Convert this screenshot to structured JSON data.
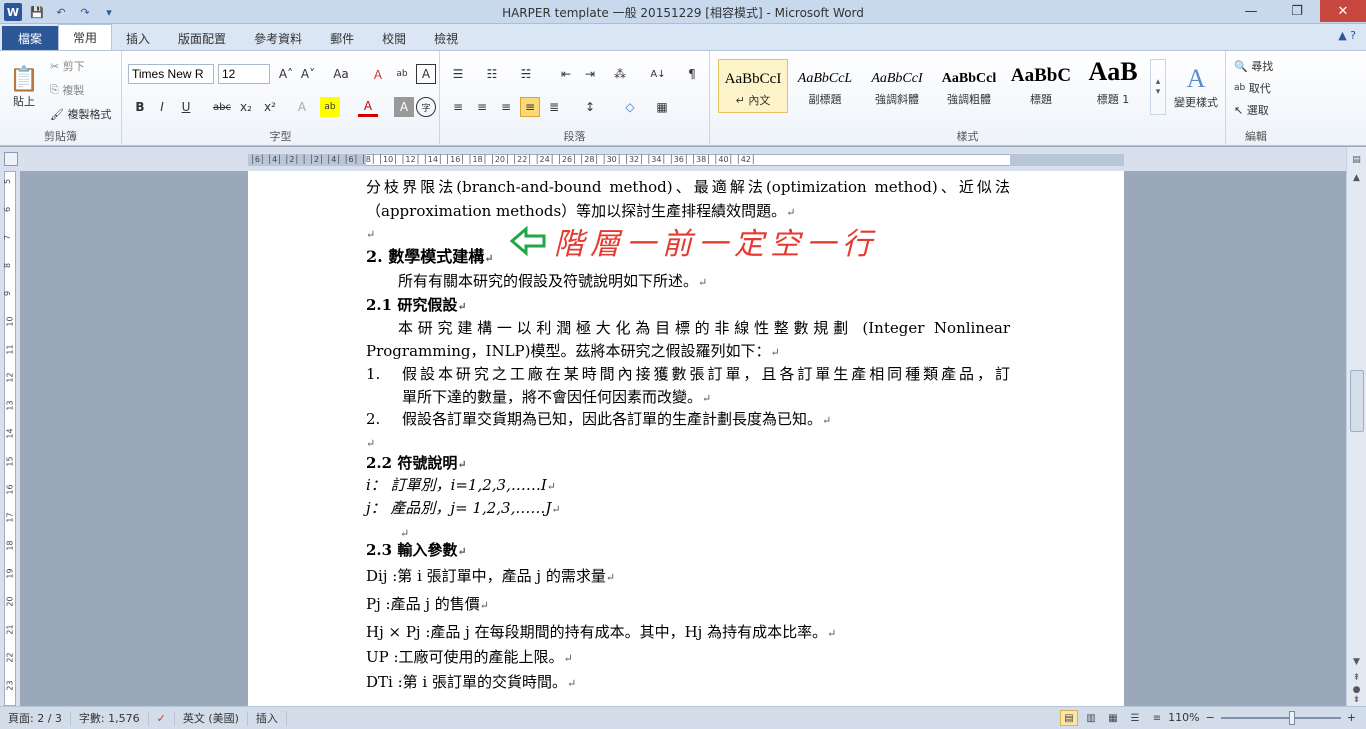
{
  "window": {
    "title": "HARPER template 一般 20151229 [相容模式] - Microsoft Word",
    "qat": {
      "word": "W",
      "save": "💾",
      "undo": "↶",
      "redo": "↷",
      "more": "▾"
    },
    "min": "—",
    "restore": "❐",
    "close": "✕"
  },
  "tabs": [
    {
      "label": "檔案"
    },
    {
      "label": "常用"
    },
    {
      "label": "插入"
    },
    {
      "label": "版面配置"
    },
    {
      "label": "參考資料"
    },
    {
      "label": "郵件"
    },
    {
      "label": "校閱"
    },
    {
      "label": "檢視"
    }
  ],
  "help": "▲ ?",
  "ribbon": {
    "clipboard": {
      "label": "剪貼簿",
      "paste": "貼上",
      "cut": "剪下",
      "copy": "複製",
      "format_painter": "複製格式"
    },
    "font": {
      "label": "字型",
      "name": "Times New R",
      "size": "12",
      "grow": "A˄",
      "shrink": "A˅",
      "case": "Aa",
      "clear": "Ａ",
      "phonetic": "ab",
      "char_border": "A",
      "bold": "B",
      "italic": "I",
      "underline": "U",
      "strike": "abc",
      "sub": "x₂",
      "sup": "x²",
      "effects": "A",
      "highlight": "ab",
      "color": "A",
      "shade": "A",
      "enclose": "字"
    },
    "paragraph": {
      "label": "段落",
      "bullets": "☰",
      "numbering": "☷",
      "multilevel": "☵",
      "decrease": "⇤",
      "increase": "⇥",
      "sort": "A↓",
      "marks": "¶",
      "cjk": "⁂",
      "left": "≡",
      "center": "≡",
      "right": "≡",
      "justify": "≡",
      "distributed": "≣",
      "spacing": "↕",
      "shading": "◇",
      "borders": "▦"
    },
    "styles": {
      "label": "樣式",
      "items": [
        {
          "sample": "AaBbCcI",
          "name": "↵ 內文"
        },
        {
          "sample": "AaBbCcL",
          "name": "副標題"
        },
        {
          "sample": "AaBbCcI",
          "name": "強調斜體"
        },
        {
          "sample": "AaBbCcl",
          "name": "強調粗體"
        },
        {
          "sample": "AaBbC",
          "name": "標題"
        },
        {
          "sample": "AaB",
          "name": "標題 1"
        }
      ],
      "change": "變更樣式"
    },
    "editing": {
      "label": "編輯",
      "find": "尋找",
      "replace": "取代",
      "select": "選取"
    }
  },
  "ruler": {
    "numbers": "│6│  │4│  │2│  │  │2│  │4│  │6│  │8│  │10│ │12│ │14│ │16│ │18│ │20│ │22│ │24│ │26│ │28│ │30│ │32│ │34│ │36│ │38│ │40│ │42│"
  },
  "vruler": [
    "5",
    "6",
    "7",
    "8",
    "9",
    "10",
    "11",
    "12",
    "13",
    "14",
    "15",
    "16",
    "17",
    "18",
    "19",
    "20",
    "21",
    "22",
    "23"
  ],
  "doc": {
    "p1a": "分枝界限法(branch-and-bound method)、最適解法(optimization method)、近似法",
    "p1b": "（approximation methods）等加以探討生產排程績效問題。",
    "mark": "↵",
    "h2": "2.  數學模式建構",
    "annot_red": "階層一前一定空一行",
    "p2": "所有有關本研究的假設及符號說明如下所述。",
    "h21": "2.1  研究假設",
    "p3a": "本研究建構一以利潤極大化為目標的非線性整數規劃 (Integer Nonlinear",
    "p3b": "Programming，INLP)模型。茲將本研究之假設羅列如下：",
    "l1n": "1.",
    "l1a": "假設本研究之工廠在某時間內接獲數張訂單，且各訂單生產相同種類產品，訂",
    "l1b": "單所下達的數量，將不會因任何因素而改變。",
    "l2n": "2.",
    "l2a": "假設各訂單交貨期為已知，因此各訂單的生產計劃長度為已知。",
    "h22": "2.2  符號說明",
    "s1": "i： 訂單別，i=1,2,3,……I",
    "s2": "j： 產品別，j= 1,2,3,……J",
    "h23": "2.3  輸入參數",
    "d1": "Dij :第 i 張訂單中，產品 j 的需求量",
    "d2": "Pj :產品 j 的售價",
    "d3": "Hj × Pj :產品 j 在每段期間的持有成本。其中，Hj 為持有成本比率。",
    "d4": "UP :工廠可使用的產能上限。",
    "d5": "DTi :第 i 張訂單的交貨時間。"
  },
  "status": {
    "page": "頁面: 2 / 3",
    "words": "字數: 1,576",
    "lang": "英文 (美國)",
    "mode": "插入",
    "zoom": "110%",
    "minus": "−",
    "plus": "+"
  },
  "colors": {
    "accent": "#2b579a",
    "annot_red": "#e53a2f",
    "annot_green": "#1fa647"
  }
}
